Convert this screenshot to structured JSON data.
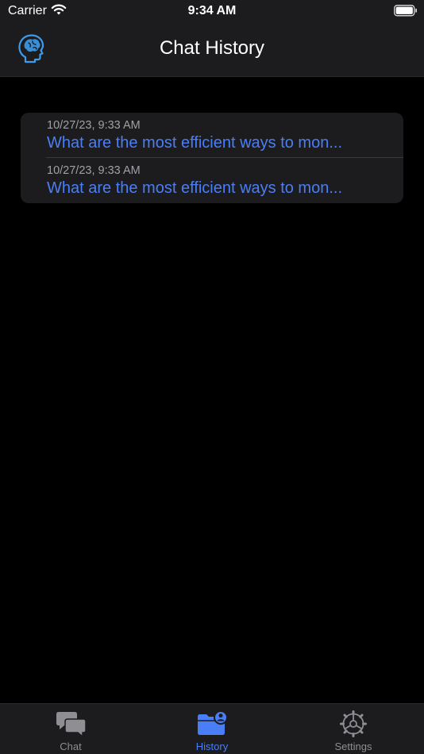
{
  "status_bar": {
    "carrier": "Carrier",
    "time": "9:34 AM"
  },
  "nav": {
    "title": "Chat History",
    "logo_icon": "brain-head-icon"
  },
  "history": [
    {
      "date": "10/27/23, 9:33 AM",
      "title": "What are the most efficient ways to mon..."
    },
    {
      "date": "10/27/23, 9:33 AM",
      "title": "What are the most efficient ways to mon..."
    }
  ],
  "tabs": [
    {
      "label": "Chat",
      "icon": "chat-bubbles-icon",
      "selected": false
    },
    {
      "label": "History",
      "icon": "folder-person-icon",
      "selected": true
    },
    {
      "label": "Settings",
      "icon": "gear-icon",
      "selected": false
    }
  ],
  "colors": {
    "accent": "#4a7ef7",
    "background": "#000000",
    "surface": "#1c1c1e",
    "secondary_text": "#a0a0a5",
    "inactive_tab": "#8e8e93"
  }
}
